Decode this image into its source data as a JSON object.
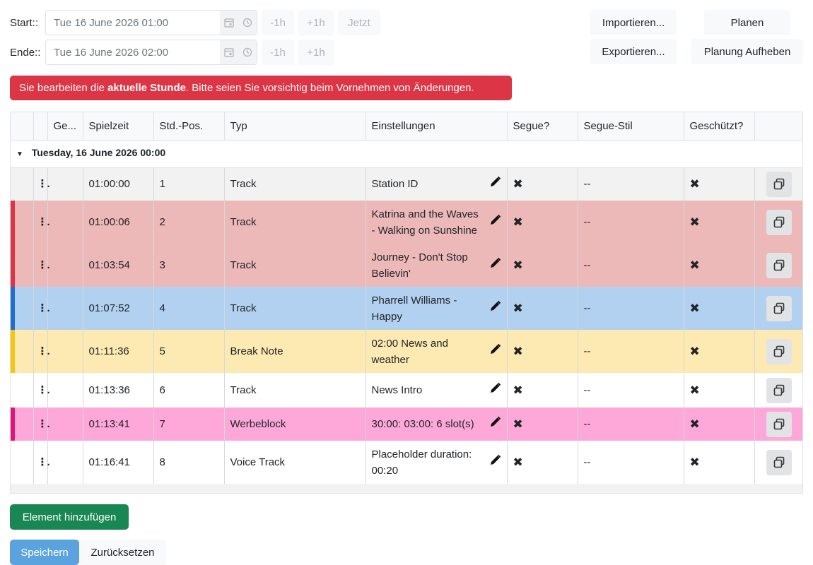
{
  "toolbar": {
    "start_label": "Start::",
    "start_value": "Tue 16 June 2026 01:00",
    "end_label": "Ende::",
    "end_value": "Tue 16 June 2026 02:00",
    "minus_1h": "-1h",
    "plus_1h": "+1h",
    "now": "Jetzt",
    "import_label": "Importieren...",
    "export_label": "Exportieren...",
    "plan_label": "Planen",
    "unplan_label": "Planung Aufheben"
  },
  "alert": {
    "before": "Sie bearbeiten die ",
    "bold": "aktuelle Stunde",
    "after": ". Bitte seien Sie vorsichtig beim Vornehmen von Änderungen.",
    "color": "#dc3545"
  },
  "table": {
    "headers": [
      "",
      "",
      "Ge...",
      "Spielzeit",
      "Std.-Pos.",
      "Typ",
      "Einstellungen",
      "Segue?",
      "Segue-Stil",
      "Geschützt?",
      ""
    ],
    "group_label": "Tuesday, 16 June 2026 00:00",
    "rows": [
      {
        "time": "01:00:00",
        "pos": "1",
        "type": "Track",
        "settings": "Station ID",
        "segue_style": "--",
        "bg": "#f2f2f2",
        "accent": ""
      },
      {
        "time": "01:00:06",
        "pos": "2",
        "type": "Track",
        "settings": "Katrina and the Waves - Walking on Sunshine",
        "segue_style": "--",
        "bg": "#edb8b8",
        "accent": "#dc3545"
      },
      {
        "time": "01:03:54",
        "pos": "3",
        "type": "Track",
        "settings": "Journey - Don't Stop Believin'",
        "segue_style": "--",
        "bg": "#edb8b8",
        "accent": "#dc3545"
      },
      {
        "time": "01:07:52",
        "pos": "4",
        "type": "Track",
        "settings": "Pharrell Williams - Happy",
        "segue_style": "--",
        "bg": "#b2d1f0",
        "accent": "#1f6fd0"
      },
      {
        "time": "01:11:36",
        "pos": "5",
        "type": "Break Note",
        "settings": "02:00 News and weather",
        "segue_style": "--",
        "bg": "#fdeab2",
        "accent": "#f5c518"
      },
      {
        "time": "01:13:36",
        "pos": "6",
        "type": "Track",
        "settings": "News Intro",
        "segue_style": "--",
        "bg": "#ffffff",
        "accent": ""
      },
      {
        "time": "01:13:41",
        "pos": "7",
        "type": "Werbeblock",
        "settings": "30:00: 03:00: 6 slot(s)",
        "segue_style": "--",
        "bg": "#fda8d8",
        "accent": "#e0157a"
      },
      {
        "time": "01:16:41",
        "pos": "8",
        "type": "Voice Track",
        "settings": "Placeholder duration: 00:20",
        "segue_style": "--",
        "bg": "#ffffff",
        "accent": ""
      }
    ]
  },
  "footer": {
    "add_label": "Element hinzufügen",
    "save_label": "Speichern",
    "reset_label": "Zurücksetzen"
  }
}
